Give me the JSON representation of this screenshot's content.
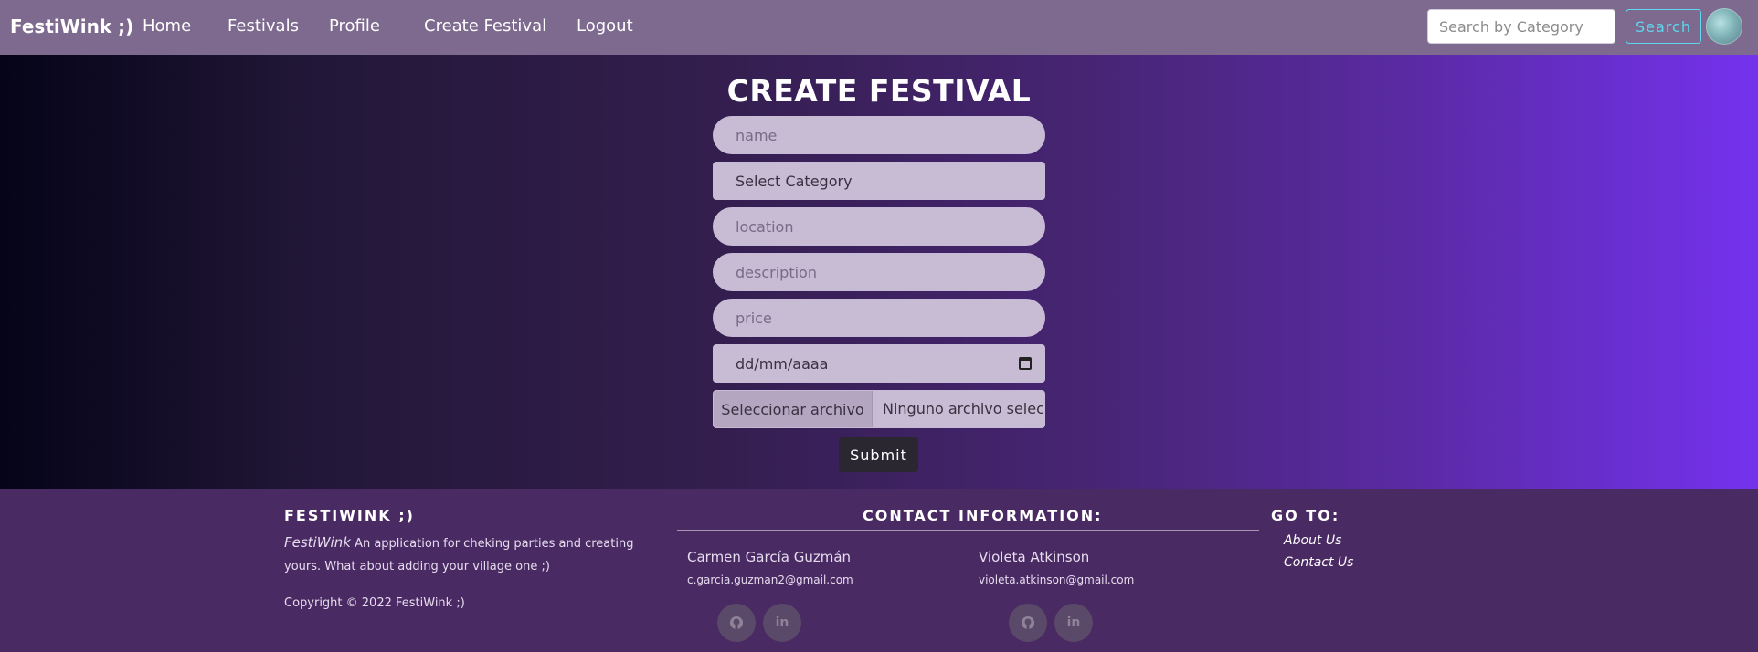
{
  "nav": {
    "brand": "FestiWink ;)",
    "links": [
      "Home",
      "Festivals",
      "Profile",
      "Create Festival",
      "Logout"
    ],
    "search_placeholder": "Search by Category",
    "search_button": "Search"
  },
  "form": {
    "title": "CREATE FESTIVAL",
    "name_placeholder": "name",
    "category_selected": "Select Category",
    "location_placeholder": "location",
    "description_placeholder": "description",
    "price_placeholder": "price",
    "date_placeholder": "dd/mm/aaaa",
    "file_button": "Seleccionar archivo",
    "file_status": "Ninguno archivo selec.",
    "submit": "Submit"
  },
  "footer": {
    "brand_heading": "FESTIWINK ;)",
    "brand_name": "FestiWink",
    "description": "An application for cheking parties and creating yours. What about adding your village one ;)",
    "copyright": "Copyright © 2022 FestiWink ;)",
    "contact_heading": "CONTACT INFORMATION:",
    "contacts": [
      {
        "name": "Carmen García Guzmán",
        "email": "c.garcia.guzman2@gmail.com"
      },
      {
        "name": "Violeta Atkinson",
        "email": "violeta.atkinson@gmail.com"
      }
    ],
    "goto_heading": "GO TO:",
    "goto_links": [
      "About Us",
      "Contact Us"
    ],
    "icons": [
      "github-icon",
      "linkedin-icon"
    ]
  },
  "colors": {
    "navbar": "#7e6a8f",
    "footer": "#4a2a62",
    "search_accent": "#5dd8ee",
    "gradient_end": "#7432ee"
  }
}
